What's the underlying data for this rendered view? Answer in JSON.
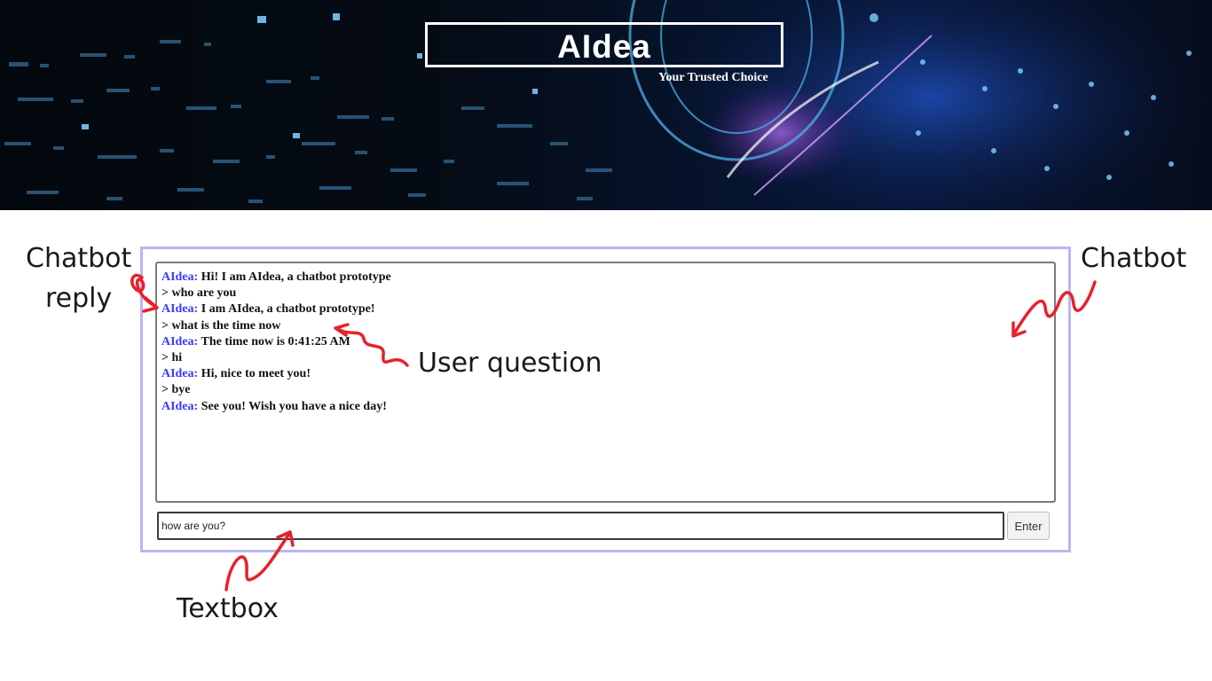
{
  "banner": {
    "title": "AIdea",
    "tagline": "Your Trusted Choice"
  },
  "chat": {
    "messages": [
      {
        "speaker": "AIdea:",
        "text": " Hi! I am AIdea, a chatbot prototype"
      },
      {
        "speaker": "",
        "text": "> who are you"
      },
      {
        "speaker": "AIdea:",
        "text": " I am AIdea, a chatbot prototype!"
      },
      {
        "speaker": "",
        "text": "> what is the time now"
      },
      {
        "speaker": "AIdea:",
        "text": " The time now is 0:41:25 AM"
      },
      {
        "speaker": "",
        "text": "> hi"
      },
      {
        "speaker": "AIdea:",
        "text": " Hi, nice to meet you!"
      },
      {
        "speaker": "",
        "text": "> bye"
      },
      {
        "speaker": "AIdea:",
        "text": " See you! Wish you have a nice day!"
      }
    ],
    "input_value": "how are you?",
    "enter_label": "Enter"
  },
  "annotations": {
    "chatbot_reply_line1": "Chatbot",
    "chatbot_reply_line2": "reply",
    "chatbot": "Chatbot",
    "user_question": "User question",
    "textbox": "Textbox",
    "arrow_color": "#e8202a"
  },
  "colors": {
    "speaker": "#3a3aff",
    "panel_border": "#b9b6f5"
  }
}
